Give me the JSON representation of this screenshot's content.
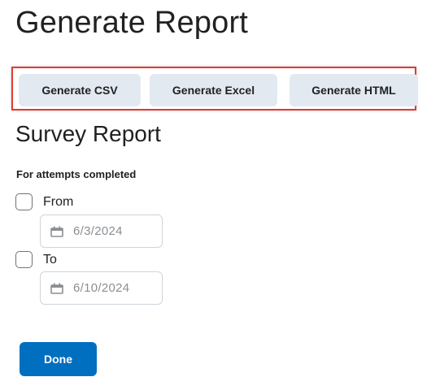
{
  "page": {
    "title": "Generate Report"
  },
  "generate_buttons": {
    "csv_label": "Generate CSV",
    "excel_label": "Generate Excel",
    "html_label": "Generate HTML",
    "highlight_color": "#e53935",
    "button_bg_color": "#e3e9f1"
  },
  "survey_report": {
    "title": "Survey Report",
    "attempts_label": "For attempts completed",
    "from": {
      "label": "From",
      "checked": false,
      "date_value": "6/3/2024",
      "icon": "calendar-icon"
    },
    "to": {
      "label": "To",
      "checked": false,
      "date_value": "6/10/2024",
      "icon": "calendar-icon"
    }
  },
  "footer": {
    "done_label": "Done",
    "done_color": "#006fbf"
  }
}
